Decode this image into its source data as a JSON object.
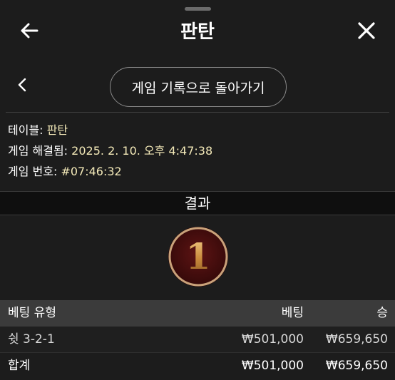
{
  "header": {
    "title": "판탄",
    "back_icon": "arrow-left-icon",
    "close_icon": "close-icon"
  },
  "subnav": {
    "back_icon": "chevron-left-icon",
    "back_to_history_label": "게임 기록으로 돌아가기"
  },
  "info": {
    "table_label": "테이블:",
    "table_value": "판탄",
    "settled_label": "게임 해결됨:",
    "settled_value": "2025. 2. 10. 오후 4:47:38",
    "number_label": "게임 번호:",
    "number_value": "#07:46:32"
  },
  "result": {
    "heading": "결과",
    "value": "1"
  },
  "bets_table": {
    "headers": [
      "베팅 유형",
      "베팅",
      "승"
    ],
    "rows": [
      {
        "type": "쉿 3-2-1",
        "bet": "₩501,000",
        "win": "₩659,650"
      }
    ],
    "total": {
      "label": "합계",
      "bet": "₩501,000",
      "win": "₩659,650"
    }
  },
  "colors": {
    "background": "#1c1c1c",
    "value_text": "#f3e9b8",
    "badge_fill": "#4a0f0f",
    "badge_ring": "#c9a27a",
    "gold": "#e0b063"
  }
}
